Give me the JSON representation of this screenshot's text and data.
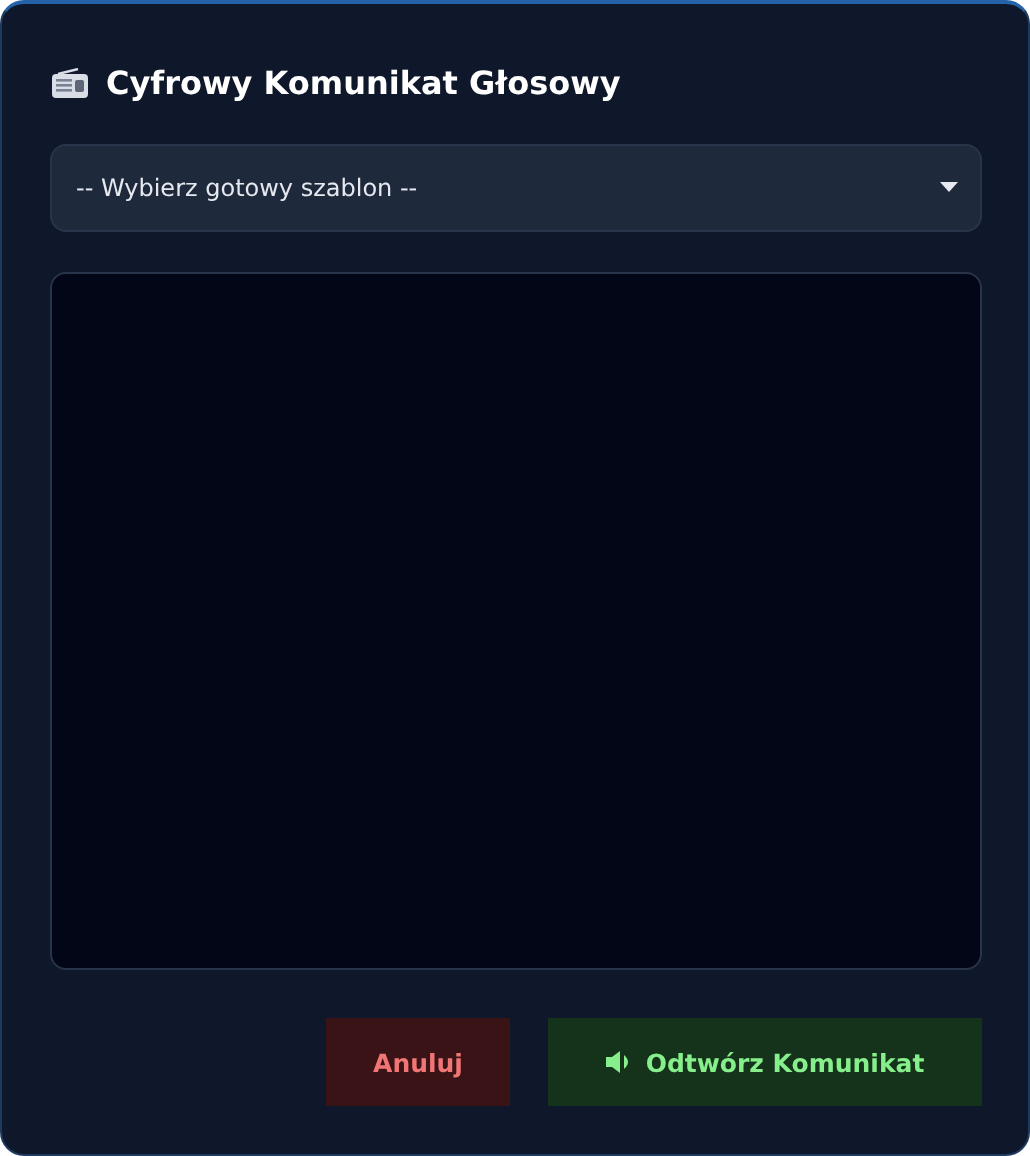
{
  "dialog": {
    "title": "Cyfrowy Komunikat Głosowy"
  },
  "template_select": {
    "value": "-- Wybierz gotowy szablon --"
  },
  "buttons": [
    {
      "kind": "cancel",
      "label": "Anuluj"
    },
    {
      "kind": "play",
      "label": "Odtwórz Komunikat"
    }
  ]
}
